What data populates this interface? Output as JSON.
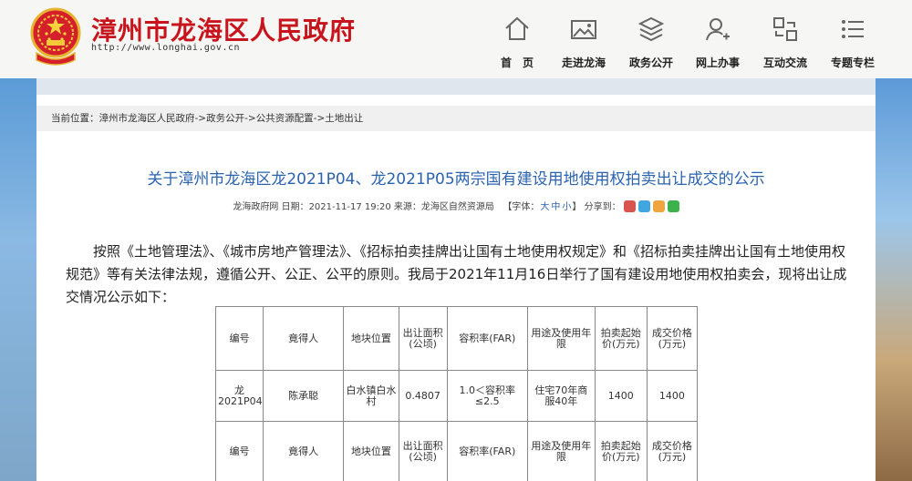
{
  "header": {
    "title": "漳州市龙海区人民政府",
    "url": "http://www.longhai.gov.cn",
    "nav": [
      {
        "label": "首　页",
        "icon": "home-icon"
      },
      {
        "label": "走进龙海",
        "icon": "image-gallery-icon"
      },
      {
        "label": "政务公开",
        "icon": "layers-icon"
      },
      {
        "label": "网上办事",
        "icon": "user-service-icon"
      },
      {
        "label": "互动交流",
        "icon": "exchange-arrows-icon"
      },
      {
        "label": "专题专栏",
        "icon": "list-icon"
      }
    ]
  },
  "breadcrumb": {
    "prefix": "当前位置：",
    "items": [
      "漳州市龙海区人民政府",
      "政务公开",
      "公共资源配置",
      "土地出让"
    ],
    "separator": "->"
  },
  "article": {
    "title": "关于漳州市龙海区龙2021P04、龙2021P05两宗国有建设用地使用权拍卖出让成交的公示",
    "meta": {
      "source_site": "龙海政府网",
      "date_label": "日期：",
      "date": "2021-11-17 19:20",
      "origin_label": "来源：",
      "origin": "龙海区自然资源局",
      "font_label": "【字体：",
      "font_sizes": [
        "大",
        "中",
        "小"
      ],
      "font_close": "】",
      "share_label": "分享到："
    },
    "body": "按照《土地管理法》、《城市房地产管理法》、《招标拍卖挂牌出让国有土地使用权规定》和《招标拍卖挂牌出让国有土地使用权规范》等有关法律法规，遵循公开、公正、公平的原则。我局于2021年11月16日举行了国有建设用地使用权拍卖会，现将出让成交情况公示如下："
  },
  "table": {
    "headers": [
      "编号",
      "竟得人",
      "地块位置",
      "出让面积(公顷)",
      "容积率(FAR)",
      "用途及使用年限",
      "拍卖起始价(万元)",
      "成交价格(万元)"
    ],
    "row": [
      "龙2021P04",
      "陈承聪",
      "白水镇白水村",
      "0.4807",
      "1.0＜容积率≤2.5",
      "住宅70年商服40年",
      "1400",
      "1400"
    ]
  },
  "colors": {
    "title_red": "#c8141d",
    "link_blue": "#2a63b0",
    "share_icons": [
      "#d9534f",
      "#3fa6e0",
      "#f0a640",
      "#3db14b"
    ]
  }
}
